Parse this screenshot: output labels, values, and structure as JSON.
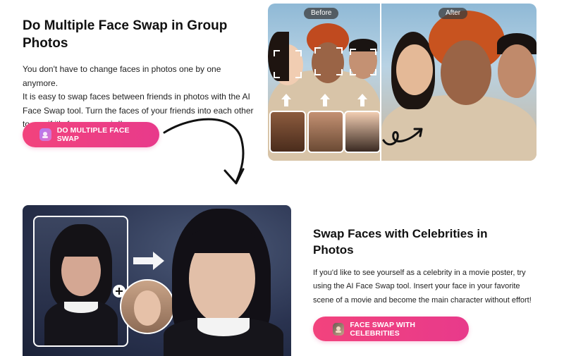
{
  "section1": {
    "heading": "Do Multiple Face Swap in Group Photos",
    "heading_line1": "Do Multiple Face Swap in Group",
    "heading_line2": "Photos",
    "paragraph_lines": [
      "You don't have to change faces in photos one by one anymore.",
      "It is easy to swap faces between friends in photos with the AI",
      "Face Swap tool. Turn the faces of your friends into each other",
      "to see if it's funny or weird!"
    ],
    "button_label": "DO MULTIPLE FACE SWAP",
    "before_label": "Before",
    "after_label": "After"
  },
  "section2": {
    "heading_line1": "Swap Faces with Celebrities in",
    "heading_line2": "Photos",
    "paragraph_lines": [
      "If you'd like to see yourself as a celebrity in a movie poster, try",
      "using the AI Face Swap tool. Insert your face in your favorite",
      "scene of a movie and become the main character without effort!"
    ],
    "button_label": "FACE SWAP WITH CELEBRITIES"
  },
  "colors": {
    "cta_pink": "#ee3f85",
    "heading": "#111111",
    "body_text": "#222222"
  },
  "icons": [
    "face-swap-app-icon",
    "celebrity-app-icon",
    "curved-arrow-icon",
    "plus-icon",
    "right-arrow-icon",
    "up-arrow-icon"
  ]
}
